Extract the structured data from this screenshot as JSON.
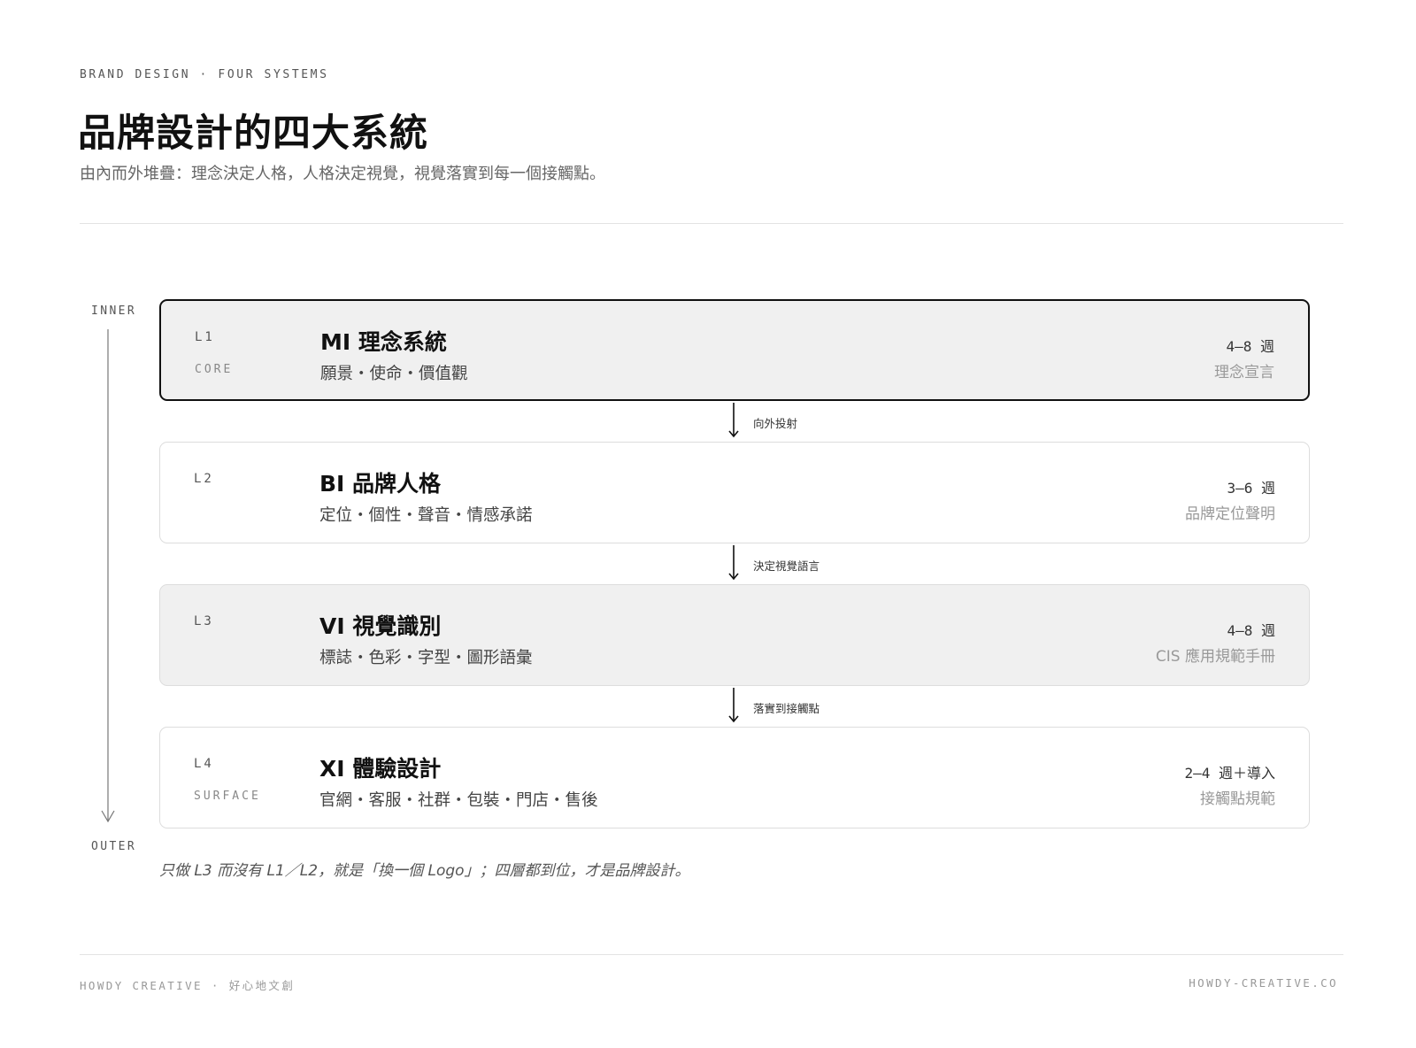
{
  "header": {
    "eyebrow": "BRAND DESIGN · FOUR SYSTEMS",
    "title": "品牌設計的四大系統",
    "subtitle": "由內而外堆疊：理念決定人格，人格決定視覺，視覺落實到每一個接觸點。"
  },
  "axis": {
    "inner_label": "INNER",
    "outer_label": "OUTER",
    "direction": "down"
  },
  "layers": [
    {
      "level": "L1",
      "tag": "CORE",
      "name": "MI 理念系統",
      "items": "願景・使命・價值觀",
      "duration": "4–8 週",
      "deliverable": "理念宣言",
      "style": "core"
    },
    {
      "level": "L2",
      "tag": "",
      "name": "BI 品牌人格",
      "items": "定位・個性・聲音・情感承諾",
      "duration": "3–6 週",
      "deliverable": "品牌定位聲明",
      "style": "plain"
    },
    {
      "level": "L3",
      "tag": "",
      "name": "VI 視覺識別",
      "items": "標誌・色彩・字型・圖形語彙",
      "duration": "4–8 週",
      "deliverable": "CIS 應用規範手冊",
      "style": "filled"
    },
    {
      "level": "L4",
      "tag": "SURFACE",
      "name": "XI 體驗設計",
      "items": "官網・客服・社群・包裝・門店・售後",
      "duration": "2–4 週＋導入",
      "deliverable": "接觸點規範",
      "style": "plain"
    }
  ],
  "connectors": [
    {
      "label": "向外投射"
    },
    {
      "label": "決定視覺語言"
    },
    {
      "label": "落實到接觸點"
    }
  ],
  "note": "只做 L3 而沒有 L1／L2，就是「換一個 Logo」；四層都到位，才是品牌設計。",
  "footer": {
    "left": "HOWDY CREATIVE · 好心地文創",
    "right": "HOWDY-CREATIVE.CO"
  },
  "colors": {
    "ink": "#111111",
    "muted": "#666666",
    "card_fill": "#f0f0f0",
    "card_border": "#dddddd",
    "rule": "#e3e3e3"
  }
}
